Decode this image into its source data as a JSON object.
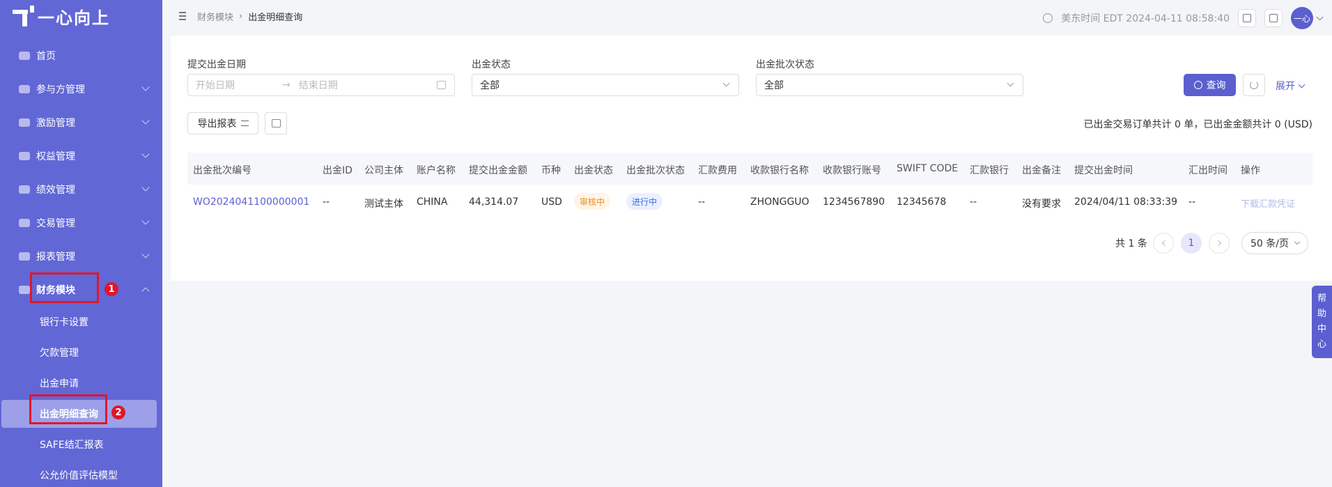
{
  "app": {
    "logo_text": "一心向上"
  },
  "sidebar": {
    "items": [
      {
        "label": "首页"
      },
      {
        "label": "参与方管理"
      },
      {
        "label": "激励管理"
      },
      {
        "label": "权益管理"
      },
      {
        "label": "绩效管理"
      },
      {
        "label": "交易管理"
      },
      {
        "label": "报表管理"
      },
      {
        "label": "财务模块"
      }
    ],
    "sub_items": [
      {
        "label": "银行卡设置"
      },
      {
        "label": "欠款管理"
      },
      {
        "label": "出金申请"
      },
      {
        "label": "出金明细查询"
      },
      {
        "label": "SAFE结汇报表"
      },
      {
        "label": "公允价值评估模型"
      }
    ],
    "annotations": [
      "1",
      "2"
    ]
  },
  "breadcrumb": {
    "parent": "财务模块",
    "current": "出金明细查询"
  },
  "header": {
    "time_text": "美东时间 EDT 2024-04-11 08:58:40",
    "avatar_text": "一心"
  },
  "filters": {
    "date_label": "提交出金日期",
    "start_placeholder": "开始日期",
    "end_placeholder": "结束日期",
    "status_label": "出金状态",
    "status_value": "全部",
    "batch_status_label": "出金批次状态",
    "batch_status_value": "全部",
    "query_label": "查询",
    "expand_label": "展开"
  },
  "toolbar": {
    "export_label": "导出报表",
    "summary": "已出金交易订单共计 0 单，已出金金额共计 0 (USD)"
  },
  "table": {
    "columns": [
      "出金批次编号",
      "出金ID",
      "公司主体",
      "账户名称",
      "提交出金金额",
      "币种",
      "出金状态",
      "出金批次状态",
      "汇款费用",
      "收款银行名称",
      "收款银行账号",
      "SWIFT CODE",
      "汇款银行",
      "出金备注",
      "提交出金时间",
      "汇出时间",
      "操作"
    ],
    "rows": [
      {
        "batch_no": "WO2024041100000001",
        "id": "--",
        "company": "测试主体",
        "account": "CHINA",
        "amount": "44,314.07",
        "currency": "USD",
        "status": "审核中",
        "batch_status": "进行中",
        "fee": "--",
        "bank_name": "ZHONGGUO",
        "bank_account": "1234567890",
        "swift": "12345678",
        "remit_bank": "--",
        "remark": "没有要求",
        "submit_time": "2024/04/11 08:33:39",
        "remit_time": "--",
        "action": "下载汇款凭证"
      }
    ]
  },
  "pagination": {
    "total": "共 1 条",
    "current": "1",
    "page_size": "50 条/页"
  },
  "help": {
    "chars": [
      "帮",
      "助",
      "中",
      "心"
    ]
  },
  "colors": {
    "sidebar": "#6267d6",
    "accent": "#5b5fcf",
    "highlight": "#e0162b"
  }
}
